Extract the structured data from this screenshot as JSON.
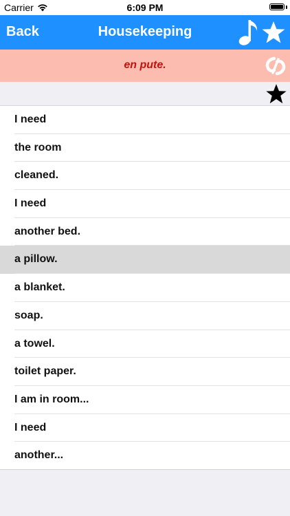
{
  "status_bar": {
    "carrier": "Carrier",
    "time": "6:09 PM"
  },
  "navbar": {
    "back_label": "Back",
    "title": "Housekeeping",
    "icons": [
      "music-note-icon",
      "star-icon"
    ],
    "color": "#1e90ff"
  },
  "phrase_banner": {
    "text": "en pute.",
    "background": "#fcbcb0",
    "text_color": "#c0140e",
    "icon": "app-logo-icon"
  },
  "favorites_row": {
    "icon": "star-icon"
  },
  "phrases": {
    "items": [
      {
        "label": "I need"
      },
      {
        "label": "the room"
      },
      {
        "label": "cleaned."
      },
      {
        "label": "I need"
      },
      {
        "label": "another bed."
      },
      {
        "label": "a pillow.",
        "selected": true
      },
      {
        "label": "a blanket."
      },
      {
        "label": "soap."
      },
      {
        "label": "a towel."
      },
      {
        "label": "toilet paper."
      },
      {
        "label": "I am in room..."
      },
      {
        "label": "I need"
      },
      {
        "label": "another..."
      }
    ]
  }
}
